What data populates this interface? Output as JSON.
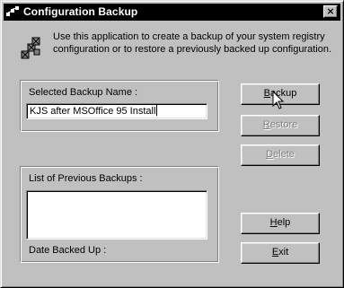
{
  "window": {
    "title": "Configuration Backup",
    "close_glyph": "×",
    "title_icon": "registry-icon",
    "app_icon": "registry-cubes-icon"
  },
  "description": "Use this application to create a backup of your system registry configuration or to restore a previously backed up configuration.",
  "backup_name": {
    "label": "Selected Backup Name :",
    "value": "KJS after MSOffice 95 Install"
  },
  "previous_backups": {
    "label": "List of Previous Backups :",
    "items": [],
    "date_label": "Date Backed Up :"
  },
  "buttons": {
    "backup": {
      "mnemonic": "B",
      "rest": "ackup",
      "enabled": true
    },
    "restore": {
      "mnemonic": "R",
      "rest": "estore",
      "enabled": false
    },
    "delete": {
      "mnemonic": "D",
      "rest": "elete",
      "enabled": false
    },
    "help": {
      "mnemonic": "H",
      "rest": "elp",
      "enabled": true
    },
    "exit": {
      "mnemonic": "E",
      "rest": "xit",
      "enabled": true
    }
  },
  "colors": {
    "face": "#c0c0c0",
    "titlebar": "#000000",
    "disabled_text": "#808080"
  }
}
